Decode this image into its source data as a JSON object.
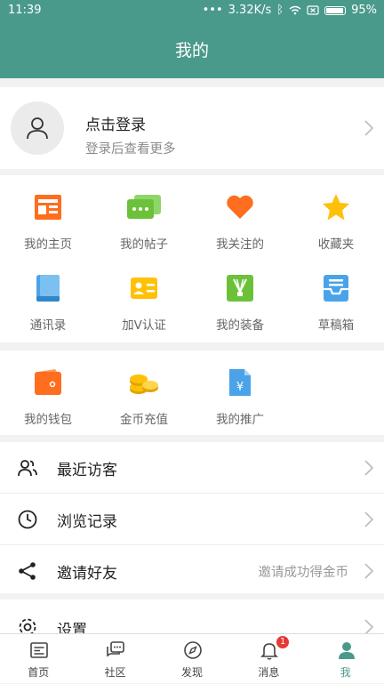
{
  "status": {
    "time": "11:39",
    "speed": "3.32K/s",
    "battery": "95%"
  },
  "header": {
    "title": "我的"
  },
  "login": {
    "title": "点击登录",
    "subtitle": "登录后查看更多"
  },
  "grid": {
    "items": [
      {
        "label": "我的主页",
        "icon": "homepage-icon",
        "color": "#ff6d1f"
      },
      {
        "label": "我的帖子",
        "icon": "posts-icon",
        "color": "#6bc23a"
      },
      {
        "label": "我关注的",
        "icon": "heart-icon",
        "color": "#ff6d1f"
      },
      {
        "label": "收藏夹",
        "icon": "star-icon",
        "color": "#ffc107"
      },
      {
        "label": "通讯录",
        "icon": "contacts-book-icon",
        "color": "#4aa3e8"
      },
      {
        "label": "加V认证",
        "icon": "verify-card-icon",
        "color": "#ffc107"
      },
      {
        "label": "我的装备",
        "icon": "shuttlecock-icon",
        "color": "#6bc23a"
      },
      {
        "label": "草稿箱",
        "icon": "drafts-tray-icon",
        "color": "#4aa3e8"
      }
    ]
  },
  "grid2": {
    "items": [
      {
        "label": "我的钱包",
        "icon": "wallet-icon",
        "color": "#ff6d1f"
      },
      {
        "label": "金币充值",
        "icon": "coins-icon",
        "color": "#ffc107"
      },
      {
        "label": "我的推广",
        "icon": "promotion-doc-icon",
        "color": "#4aa3e8"
      }
    ]
  },
  "rows": {
    "visitors": "最近访客",
    "history": "浏览记录",
    "invite": "邀请好友",
    "invite_note": "邀请成功得金币",
    "settings": "设置"
  },
  "tabs": [
    {
      "label": "首页",
      "icon": "home-tab-icon"
    },
    {
      "label": "社区",
      "icon": "community-tab-icon"
    },
    {
      "label": "发现",
      "icon": "compass-icon"
    },
    {
      "label": "消息",
      "icon": "bell-icon",
      "badge": "1"
    },
    {
      "label": "我",
      "icon": "person-icon",
      "active": true
    }
  ]
}
